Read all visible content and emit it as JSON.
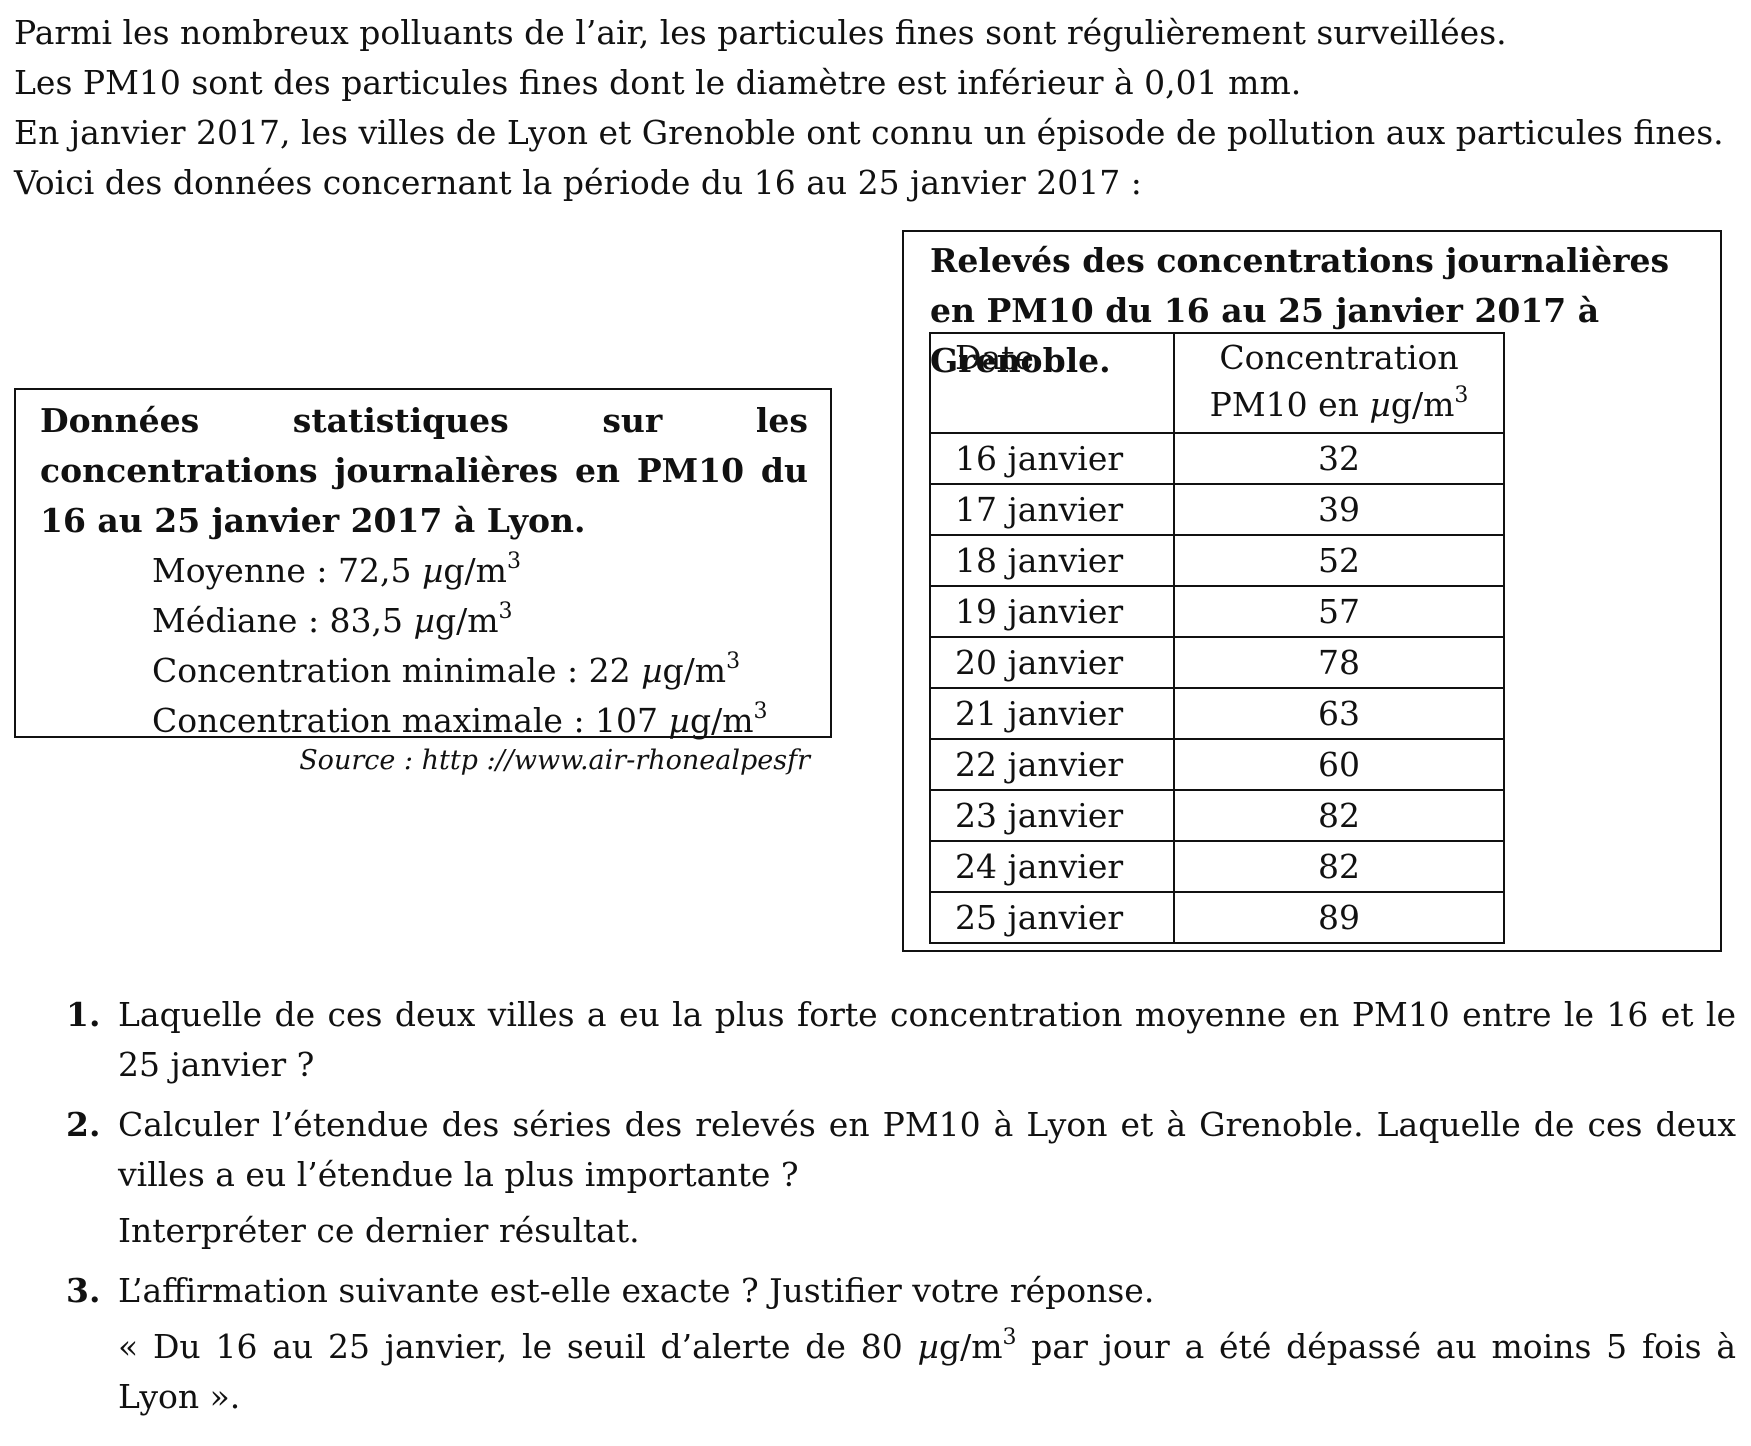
{
  "intro": [
    "Parmi les nombreux polluants de l’air, les particules fines sont régulièrement surveillées.",
    "Les PM10 sont des particules fines dont le diamètre est inférieur à 0,01 mm.",
    "En janvier 2017, les villes de Lyon et Grenoble ont connu un épisode de pollution aux particules fines.",
    "Voici des données concernant la période du 16 au 25 janvier 2017 :"
  ],
  "lyon": {
    "title": "Données statistiques sur les concentrations journalières en PM10 du 16 au 25 janvier 2017 à Lyon.",
    "stats": [
      {
        "label": "Moyenne : 72,5 ",
        "mu": "µ",
        "unit": "g/m",
        "exp": "3"
      },
      {
        "label": "Médiane : 83,5 ",
        "mu": "µ",
        "unit": "g/m",
        "exp": "3"
      },
      {
        "label": "Concentration minimale : 22 ",
        "mu": "µ",
        "unit": "g/m",
        "exp": "3"
      },
      {
        "label": "Concentration maximale : 107 ",
        "mu": "µ",
        "unit": "g/m",
        "exp": "3"
      }
    ],
    "source": "Source : http ://www.air-rhonealpesfr"
  },
  "grenoble": {
    "title": "Relevés des concentrations journalières en PM10 du 16 au 25 janvier 2017 à Grenoble.",
    "header": {
      "date": "Date",
      "conc_line1": "Concentration",
      "conc_line2": "PM10 en ",
      "mu": "µ",
      "unit": "g/m",
      "exp": "3"
    },
    "rows": [
      {
        "date": "16 janvier",
        "value": "32"
      },
      {
        "date": "17 janvier",
        "value": "39"
      },
      {
        "date": "18 janvier",
        "value": "52"
      },
      {
        "date": "19 janvier",
        "value": "57"
      },
      {
        "date": "20 janvier",
        "value": "78"
      },
      {
        "date": "21 janvier",
        "value": "63"
      },
      {
        "date": "22 janvier",
        "value": "60"
      },
      {
        "date": "23 janvier",
        "value": "82"
      },
      {
        "date": "24 janvier",
        "value": "82"
      },
      {
        "date": "25 janvier",
        "value": "89"
      }
    ]
  },
  "questions": [
    {
      "num": "1.",
      "text": "Laquelle de ces deux villes a eu la plus forte concentration moyenne en PM10 entre le 16 et le 25 janvier ?"
    },
    {
      "num": "2.",
      "text": "Calculer l’étendue des séries des relevés en PM10 à Lyon et à Grenoble. Laquelle de ces deux villes a eu l’étendue la plus importante ?",
      "extra": "Interpréter ce dernier résultat."
    },
    {
      "num": "3.",
      "text": "L’affirmation suivante est-elle exacte ? Justifier votre réponse.",
      "quote_before": "« Du 16 au 25 janvier, le seuil d’alerte de 80 ",
      "quote_mu": "µ",
      "quote_unit": "g/m",
      "quote_exp": "3",
      "quote_after": " par jour a été dépassé au moins 5 fois à Lyon »."
    }
  ]
}
